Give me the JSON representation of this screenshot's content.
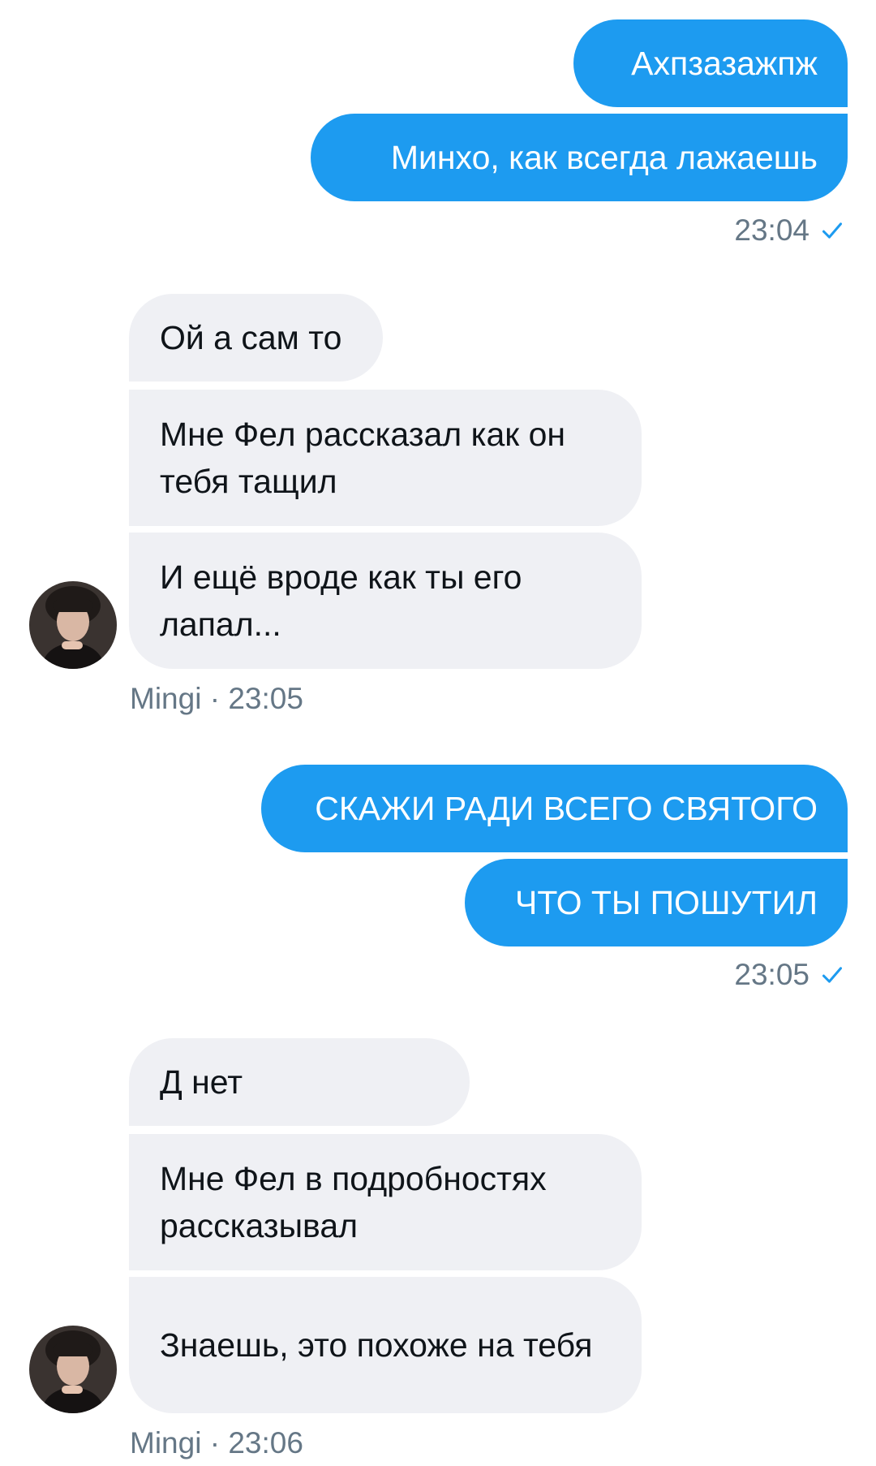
{
  "conversation": {
    "groups": [
      {
        "direction": "outgoing",
        "messages": [
          "Ахпзазажпж",
          "Минхо, как всегда лажаешь"
        ],
        "time": "23:04",
        "status_icon": "sent-check-icon"
      },
      {
        "direction": "incoming",
        "messages": [
          "Ой а сам то",
          "Мне Фел рассказал как он тебя тащил",
          "И ещё вроде как ты его лапал..."
        ],
        "sender": "Mingi",
        "separator": "·",
        "time": "23:05",
        "avatar_icon": "avatar-photo"
      },
      {
        "direction": "outgoing",
        "messages": [
          "СКАЖИ РАДИ ВСЕГО СВЯТОГО",
          "ЧТО ТЫ ПОШУТИЛ"
        ],
        "time": "23:05",
        "status_icon": "sent-check-icon"
      },
      {
        "direction": "incoming",
        "messages": [
          "Д нет",
          "Мне Фел в подробностях рассказывал",
          "Знаешь, это похоже на тебя"
        ],
        "sender": "Mingi",
        "separator": "·",
        "time": "23:06",
        "avatar_icon": "avatar-photo"
      }
    ]
  },
  "colors": {
    "outgoing_bubble": "#1d9bf0",
    "incoming_bubble": "#eff0f4",
    "meta_text": "#657786",
    "background": "#ffffff"
  }
}
